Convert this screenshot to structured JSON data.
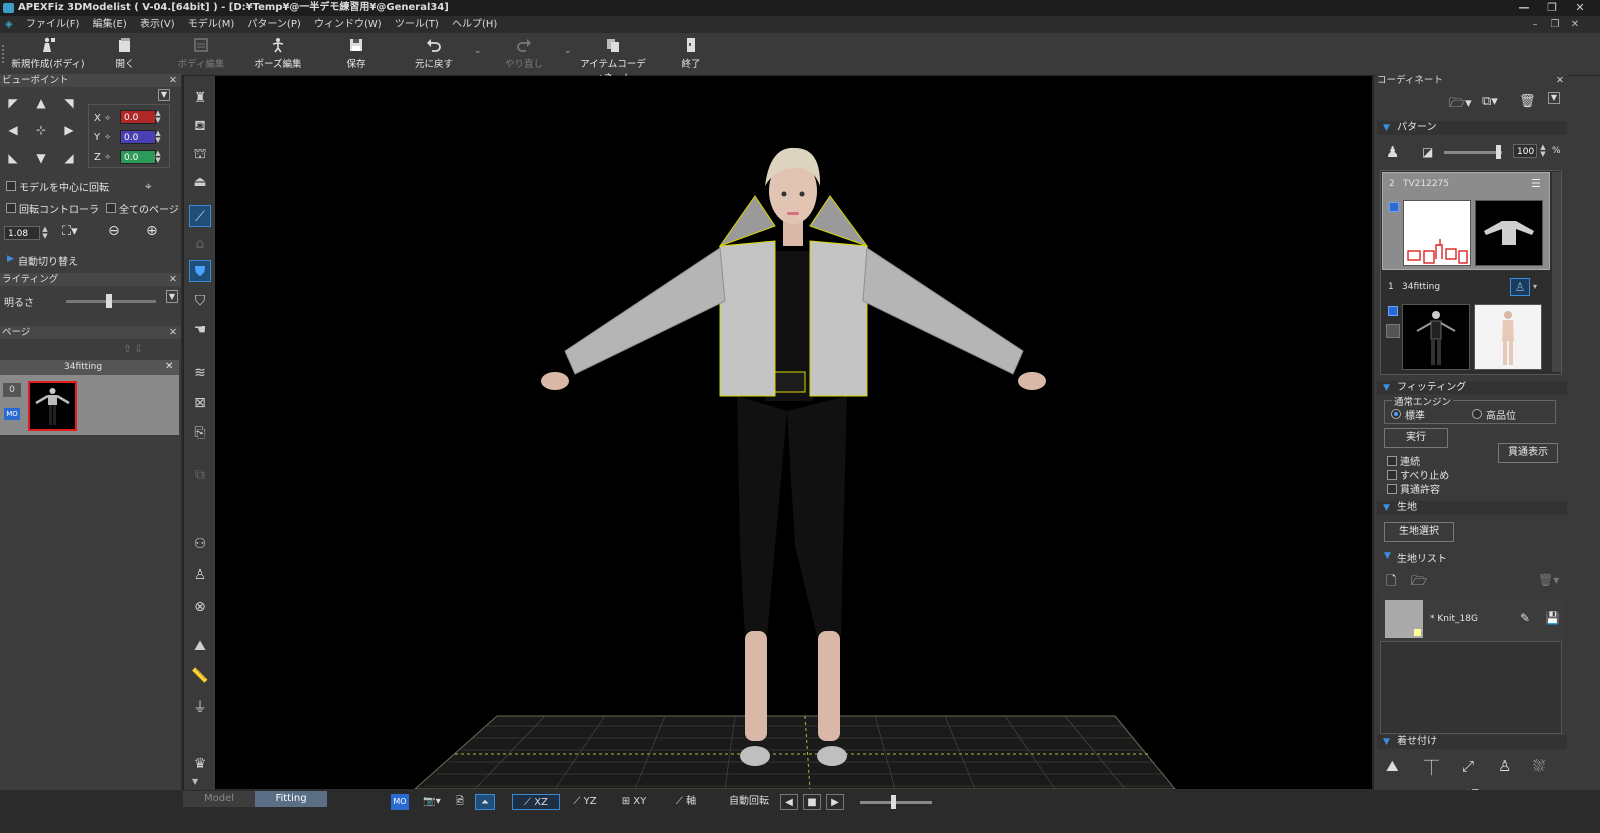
{
  "window": {
    "title": "APEXFiz 3DModelist ( V-04.[64bit] ) - [D:¥Temp¥@一半デモ練習用¥@General34]"
  },
  "menu": [
    "ファイル(F)",
    "編集(E)",
    "表示(V)",
    "モデル(M)",
    "パターン(P)",
    "ウィンドウ(W)",
    "ツール(T)",
    "ヘルプ(H)"
  ],
  "toolbar": {
    "new_label": "新規作成(ボディ)",
    "open_label": "開く",
    "body_edit_label": "ボディ編集",
    "pose_edit_label": "ポーズ編集",
    "save_label": "保存",
    "undo_label": "元に戻す",
    "redo_label": "やり直し",
    "item_coord_label": "アイテムコーディネート",
    "exit_label": "終了"
  },
  "viewpoint": {
    "title": "ビューポイント",
    "x_label": "X",
    "y_label": "Y",
    "z_label": "Z",
    "x_value": "0.0",
    "y_value": "0.0",
    "z_value": "0.0",
    "rotate_center_label": "モデルを中心に回転",
    "rotate_controller_label": "回転コントローラ",
    "all_pages_label": "全てのページ",
    "zoom_value": "1.08",
    "auto_switch_label": "自動切り替え"
  },
  "lighting": {
    "title": "ライティング",
    "brightness_label": "明るさ"
  },
  "page": {
    "title": "ページ",
    "item_name": "34fitting",
    "item_index": "0",
    "mo_badge": "MO"
  },
  "bottom": {
    "tab_model": "Model",
    "tab_fitting": "Fitting",
    "mo_badge": "MO",
    "xz_label": "XZ",
    "yz_label": "YZ",
    "xy_label": "XY",
    "axis_label": "軸",
    "auto_rotate_label": "自動回転"
  },
  "coordinate": {
    "title": "コーディネート",
    "pattern_section": "パターン",
    "opacity_value": "100",
    "opacity_unit": "%",
    "item2_index": "2",
    "item2_name": "TV212275",
    "item1_index": "1",
    "item1_name": "34fitting",
    "fitting_section": "フィッティング",
    "engine_group": "通常エンジン",
    "engine_standard": "標準",
    "engine_high": "高品位",
    "run_button": "実行",
    "penetration_button": "貫通表示",
    "opt_continuous": "連続",
    "opt_slip_stop": "すべり止め",
    "opt_penetration_allow": "貫通許容",
    "fabric_section": "生地",
    "fabric_select_button": "生地選択",
    "fabric_list_section": "生地リスト",
    "fabric_item_name": "* Knit_18G",
    "dressing_section": "着せ付け"
  },
  "colors": {
    "x_field": "#b02828",
    "y_field": "#4a3fb3",
    "z_field": "#2e9a5a",
    "accent": "#3a8de0",
    "selection_red": "#e02020"
  }
}
